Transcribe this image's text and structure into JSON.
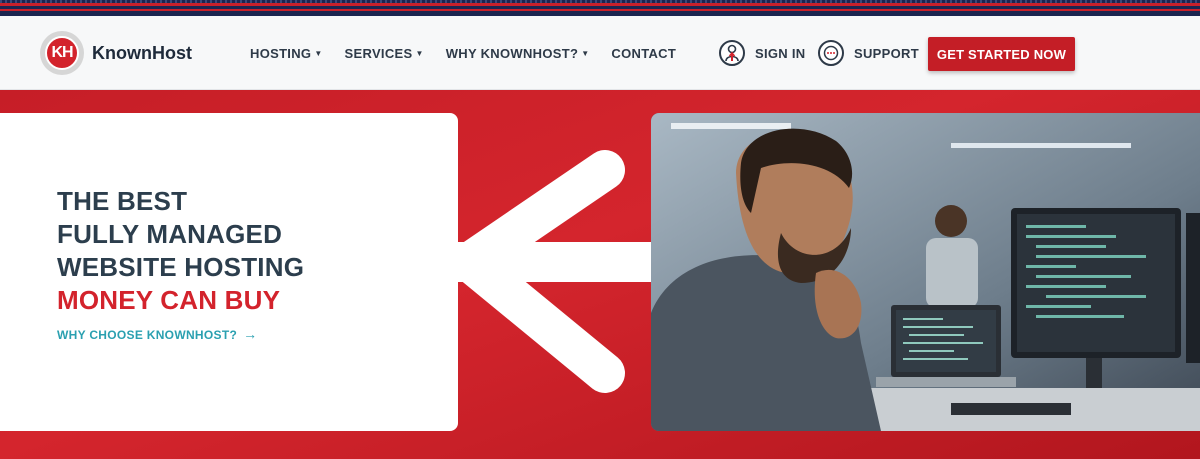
{
  "brand": {
    "name": "KnownHost",
    "mark": "KH"
  },
  "nav": [
    {
      "label": "HOSTING",
      "has_dropdown": true
    },
    {
      "label": "SERVICES",
      "has_dropdown": true
    },
    {
      "label": "WHY KNOWNHOST?",
      "has_dropdown": true
    },
    {
      "label": "CONTACT",
      "has_dropdown": false
    }
  ],
  "utility": {
    "sign_in": "SIGN IN",
    "support": "SUPPORT"
  },
  "cta": "GET STARTED NOW",
  "hero": {
    "line1": "THE BEST",
    "line2": "FULLY MANAGED",
    "line3": "WEBSITE HOSTING",
    "line4": "MONEY CAN BUY",
    "link": "WHY CHOOSE KNOWNHOST?",
    "link_arrow": "→"
  },
  "colors": {
    "brand_red": "#d3232c",
    "dark_text": "#2c3e4d",
    "teal_link": "#2aa0b0"
  }
}
